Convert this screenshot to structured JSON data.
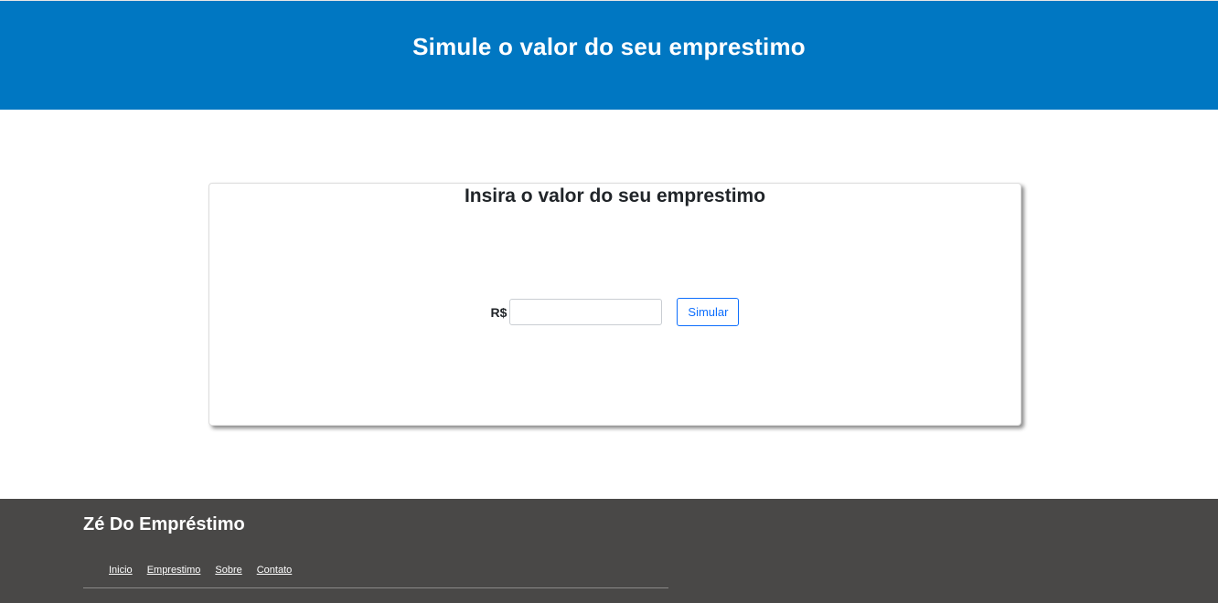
{
  "header": {
    "title": "Simule o valor do seu emprestimo"
  },
  "card": {
    "title": "Insira o valor do seu emprestimo",
    "currency_label": "R$",
    "amount_value": "",
    "amount_placeholder": "",
    "submit_label": "Simular"
  },
  "footer": {
    "brand": "Zé Do Empréstimo",
    "nav": [
      {
        "label": "Inicio"
      },
      {
        "label": "Emprestimo"
      },
      {
        "label": "Sobre"
      },
      {
        "label": "Contato"
      }
    ]
  },
  "colors": {
    "header_bg": "#0077c2",
    "footer_bg": "#494847",
    "button_accent": "#0d6efd"
  }
}
